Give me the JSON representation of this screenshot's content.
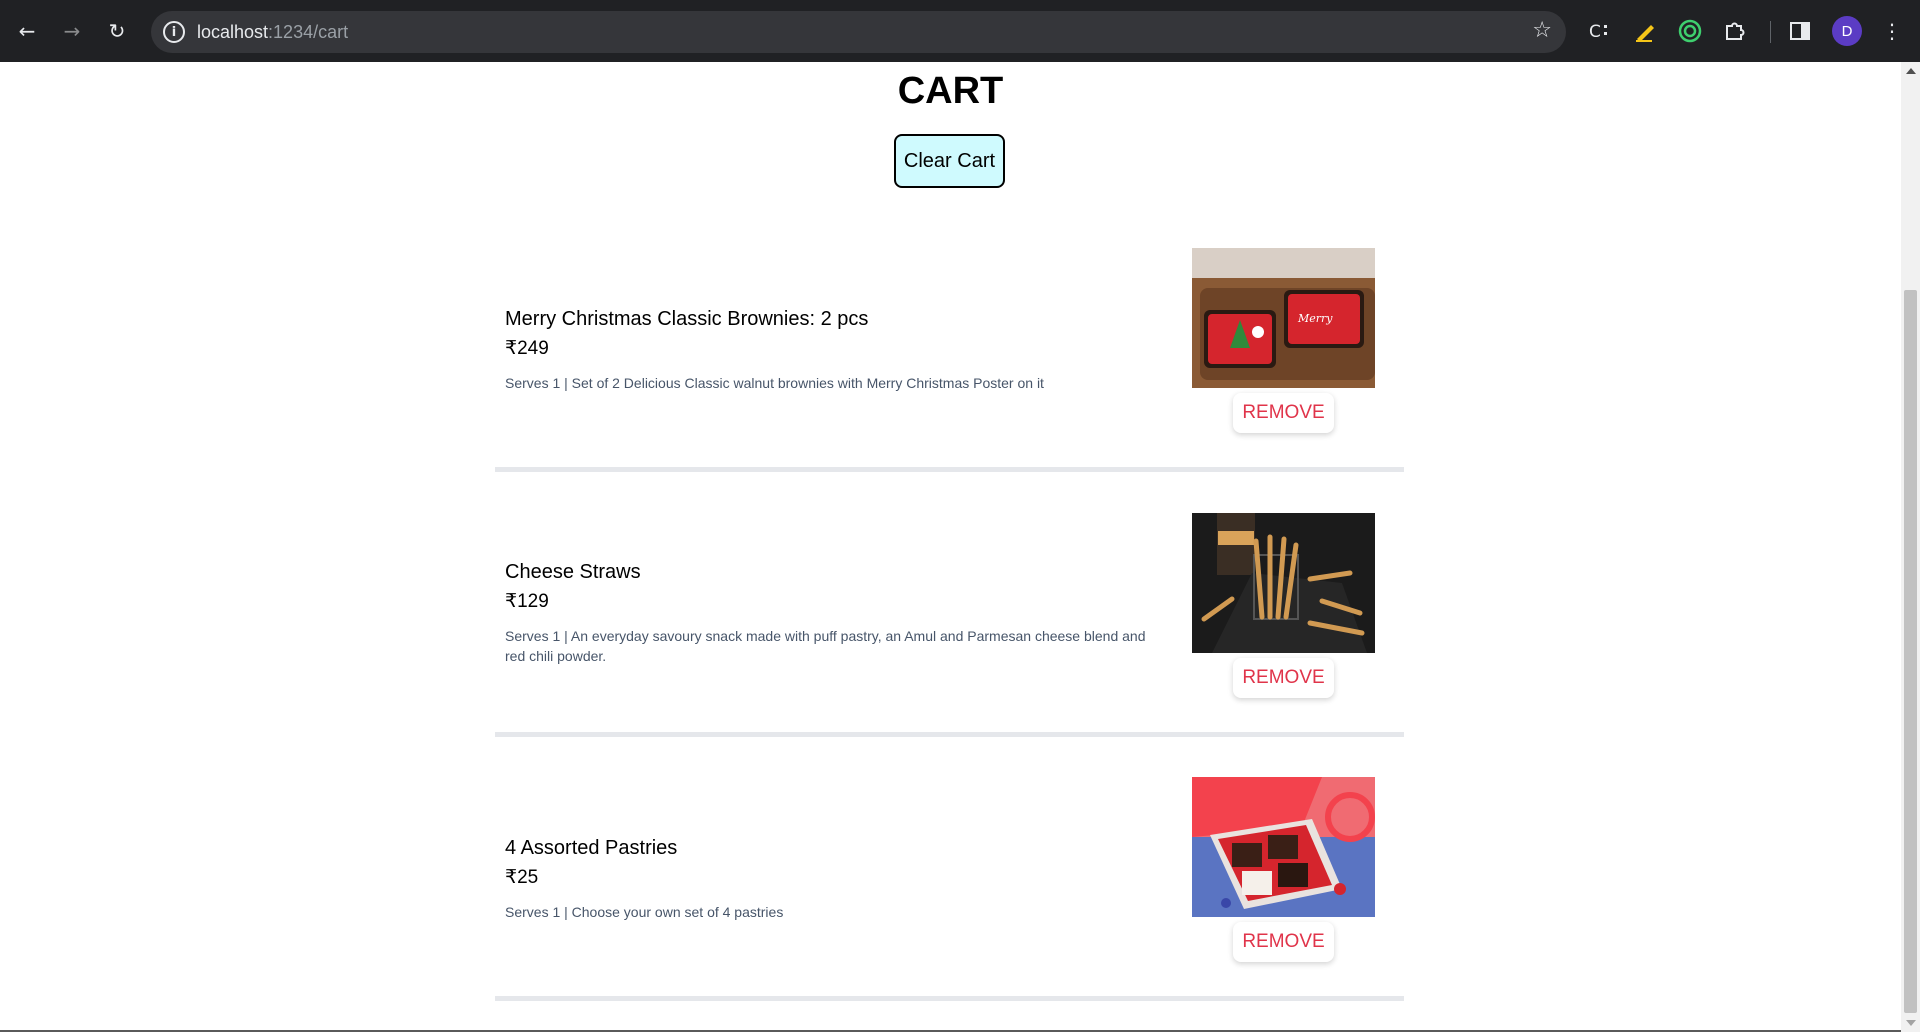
{
  "browser": {
    "url_host": "localhost",
    "url_path": ":1234/cart",
    "avatar_initial": "D"
  },
  "page": {
    "title": "CART",
    "clear_label": "Clear Cart",
    "remove_label": "REMOVE"
  },
  "items": [
    {
      "name": "Merry Christmas Classic Brownies: 2 pcs",
      "price": "₹249",
      "description": "Serves 1 | Set of 2 Delicious Classic walnut brownies with Merry Christmas Poster on it"
    },
    {
      "name": "Cheese Straws",
      "price": "₹129",
      "description": "Serves 1 | An everyday savoury snack made with puff pastry, an Amul and Parmesan cheese blend and red chili powder."
    },
    {
      "name": "4 Assorted Pastries",
      "price": "₹25",
      "description": "Serves 1 | Choose your own set of 4 pastries"
    }
  ],
  "colors": {
    "clear_bg": "#cffafe",
    "remove_text": "#e0344a",
    "divider": "#e5e7eb"
  }
}
